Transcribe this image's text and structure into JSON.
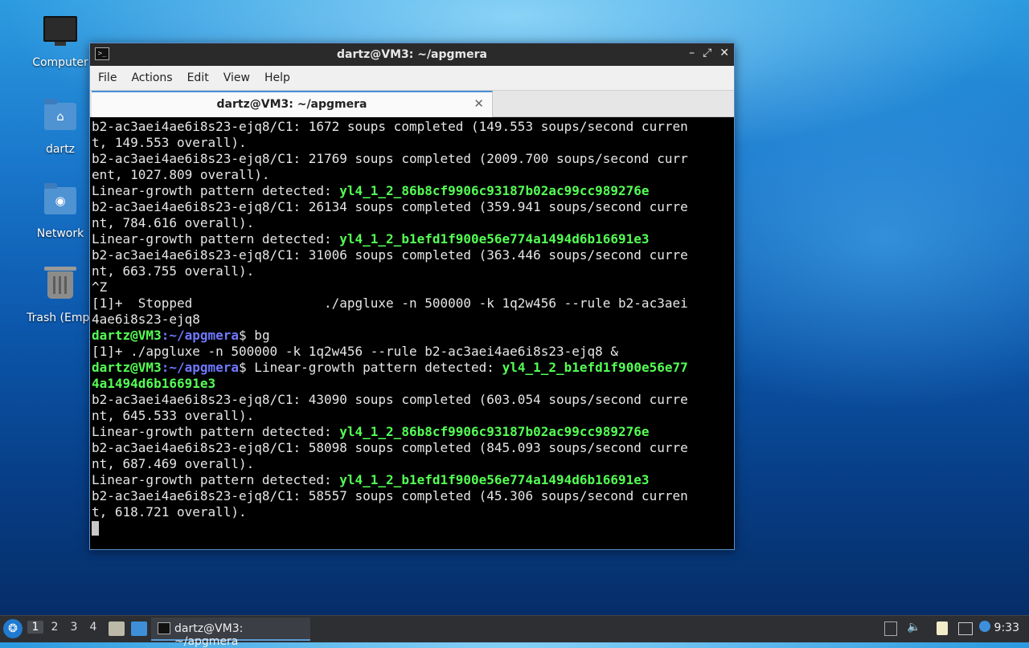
{
  "desktop": {
    "icons": [
      {
        "label": "Computer",
        "icon": "computer-icon"
      },
      {
        "label": "dartz",
        "icon": "home-folder-icon"
      },
      {
        "label": "Network",
        "icon": "network-folder-icon"
      },
      {
        "label": "Trash (Empt",
        "icon": "trash-icon"
      }
    ]
  },
  "window": {
    "title": "dartz@VM3: ~/apgmera",
    "controls": {
      "minimize": "–",
      "maximize": "⤢",
      "close": "✕"
    },
    "menu": [
      "File",
      "Actions",
      "Edit",
      "View",
      "Help"
    ],
    "tab": {
      "label": "dartz@VM3: ~/apgmera",
      "close": "✕"
    }
  },
  "terminal": {
    "prompt_user": "dartz@VM3",
    "prompt_path": ":~/apgmera",
    "prompt_end": "$",
    "lines": [
      {
        "t": "b2-ac3aei4ae6i8s23-ejq8/C1: 1672 soups completed (149.553 soups/second curren"
      },
      {
        "t": "t, 149.553 overall)."
      },
      {
        "t": "b2-ac3aei4ae6i8s23-ejq8/C1: 21769 soups completed (2009.700 soups/second curr"
      },
      {
        "t": "ent, 1027.809 overall)."
      },
      {
        "t": "Linear-growth pattern detected: ",
        "h": "yl4_1_2_86b8cf9906c93187b02ac99cc989276e"
      },
      {
        "t": "b2-ac3aei4ae6i8s23-ejq8/C1: 26134 soups completed (359.941 soups/second curre"
      },
      {
        "t": "nt, 784.616 overall)."
      },
      {
        "t": "Linear-growth pattern detected: ",
        "h": "yl4_1_2_b1efd1f900e56e774a1494d6b16691e3"
      },
      {
        "t": "b2-ac3aei4ae6i8s23-ejq8/C1: 31006 soups completed (363.446 soups/second curre"
      },
      {
        "t": "nt, 663.755 overall)."
      },
      {
        "t": "^Z"
      },
      {
        "t": "[1]+  Stopped                 ./apgluxe -n 500000 -k 1q2w456 --rule b2-ac3aei"
      },
      {
        "t": "4ae6i8s23-ejq8"
      },
      {
        "prompt": true,
        "t": " bg"
      },
      {
        "t": "[1]+ ./apgluxe -n 500000 -k 1q2w456 --rule b2-ac3aei4ae6i8s23-ejq8 &"
      },
      {
        "prompt": true,
        "t": " Linear-growth pattern detected: ",
        "h": "yl4_1_2_b1efd1f900e56e77"
      },
      {
        "h": "4a1494d6b16691e3"
      },
      {
        "t": "b2-ac3aei4ae6i8s23-ejq8/C1: 43090 soups completed (603.054 soups/second curre"
      },
      {
        "t": "nt, 645.533 overall)."
      },
      {
        "t": "Linear-growth pattern detected: ",
        "h": "yl4_1_2_86b8cf9906c93187b02ac99cc989276e"
      },
      {
        "t": "b2-ac3aei4ae6i8s23-ejq8/C1: 58098 soups completed (845.093 soups/second curre"
      },
      {
        "t": "nt, 687.469 overall)."
      },
      {
        "t": "Linear-growth pattern detected: ",
        "h": "yl4_1_2_b1efd1f900e56e774a1494d6b16691e3"
      },
      {
        "t": "b2-ac3aei4ae6i8s23-ejq8/C1: 58557 soups completed (45.306 soups/second curren"
      },
      {
        "t": "t, 618.721 overall)."
      },
      {
        "cursor": true
      }
    ],
    "colors": {
      "text": "#e6e6e6",
      "highlight": "#55ff55",
      "path": "#6f78ff",
      "background": "#000000"
    }
  },
  "taskbar": {
    "workspaces": [
      "1",
      "2",
      "3",
      "4"
    ],
    "active_workspace": "1",
    "task_label": "dartz@VM3: ~/apgmera",
    "clock": "9:33"
  }
}
